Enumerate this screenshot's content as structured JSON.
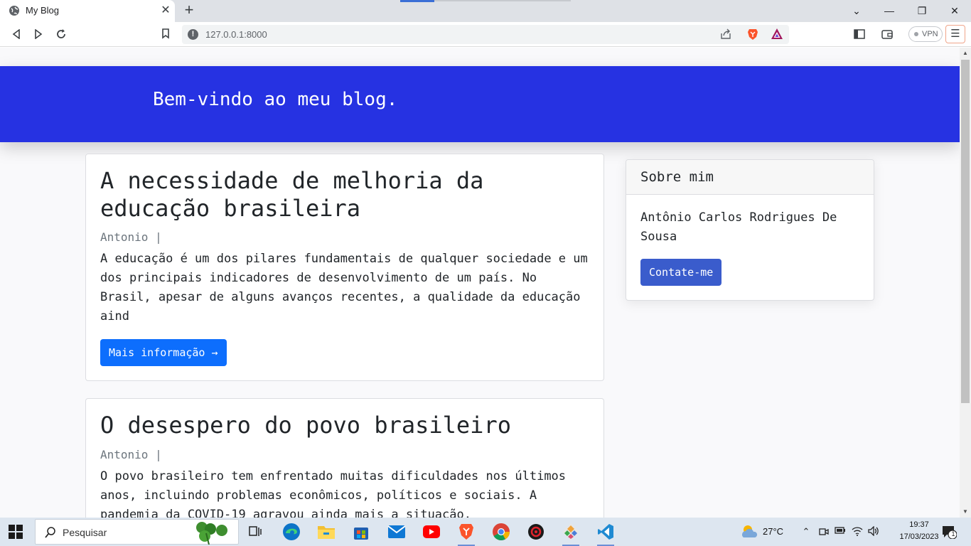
{
  "browser": {
    "tab_title": "My Blog",
    "tab_close": "✕",
    "new_tab": "+",
    "url": "127.0.0.1:8000",
    "vpn_label": "VPN",
    "window_controls": {
      "chevron": "⌄",
      "minimize": "—",
      "restore": "❐",
      "close": "✕"
    }
  },
  "hero": {
    "title": "Bem-vindo ao meu blog."
  },
  "posts": [
    {
      "title": "A necessidade de melhoria da educação brasileira",
      "meta": "Antonio |",
      "excerpt": "A educação é um dos pilares fundamentais de qualquer sociedade e um dos principais indicadores de desenvolvimento de um país. No Brasil, apesar de alguns avanços recentes, a qualidade da educação aind",
      "button": "Mais informação →"
    },
    {
      "title": "O desespero do povo brasileiro",
      "meta": "Antonio |",
      "excerpt": "O povo brasileiro tem enfrentado muitas dificuldades nos últimos anos, incluindo problemas econômicos, políticos e sociais. A pandemia da COVID-19 agravou ainda mais a situação."
    }
  ],
  "sidebar": {
    "title": "Sobre mim",
    "name": "Antônio Carlos Rodrigues De Sousa",
    "button": "Contate-me"
  },
  "taskbar": {
    "search_placeholder": "Pesquisar",
    "temperature": "27°C",
    "time": "19:37",
    "date": "17/03/2023",
    "notification_count": "1"
  },
  "colors": {
    "hero_bg": "#2632e2",
    "primary_button": "#0d6efd",
    "contact_button": "#3a5ccc"
  }
}
